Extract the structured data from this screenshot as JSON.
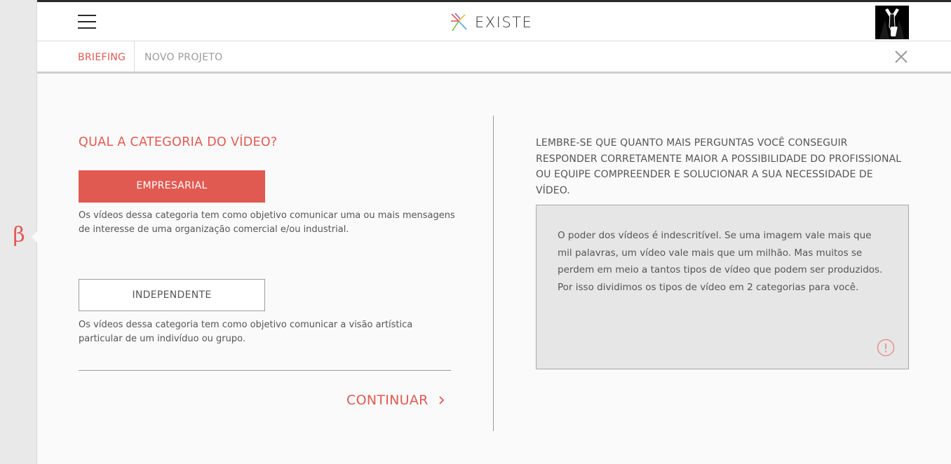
{
  "rail": {
    "badge_glyph": "β"
  },
  "header": {
    "logo_text": "EXISTE"
  },
  "subnav": {
    "briefing_label": "BRIEFING",
    "current_label": "NOVO PROJETO"
  },
  "form": {
    "question": "QUAL A CATEGORIA DO VÍDEO?",
    "options": [
      {
        "label": "EMPRESARIAL",
        "selected": true,
        "description": "Os vídeos dessa categoria tem como objetivo comunicar uma ou mais mensagens de interesse de uma organização comercial e/ou industrial."
      },
      {
        "label": "INDEPENDENTE",
        "selected": false,
        "description": "Os vídeos dessa categoria tem como objetivo comunicar a visão artística particular de um indivíduo ou grupo."
      }
    ],
    "continue_label": "CONTINUAR"
  },
  "aside": {
    "tip": "LEMBRE-SE QUE QUANTO MAIS PERGUNTAS VOCÊ CONSEGUIR RESPONDER CORRETAMENTE MAIOR A POSSIBILIDADE DO PROFISSIONAL OU EQUIPE COMPREENDER E SOLUCIONAR A SUA NECESSIDADE DE VÍDEO.",
    "info_text": "O poder dos vídeos é indescritível. Se uma imagem vale mais que mil palavras, um vídeo vale mais que um milhão. Mas muitos se perdem em meio a tantos tipos de vídeo que podem ser produzidos. Por isso dividimos os tipos de vídeo em 2 categorias para você."
  },
  "colors": {
    "accent": "#e05a52",
    "text": "#555555",
    "panel": "#e6e6e6"
  },
  "icons": [
    "hamburger-menu-icon",
    "existe-logo-icon",
    "user-avatar-icon",
    "close-icon",
    "chevron-right-icon",
    "alert-info-icon",
    "beta-badge-icon"
  ]
}
